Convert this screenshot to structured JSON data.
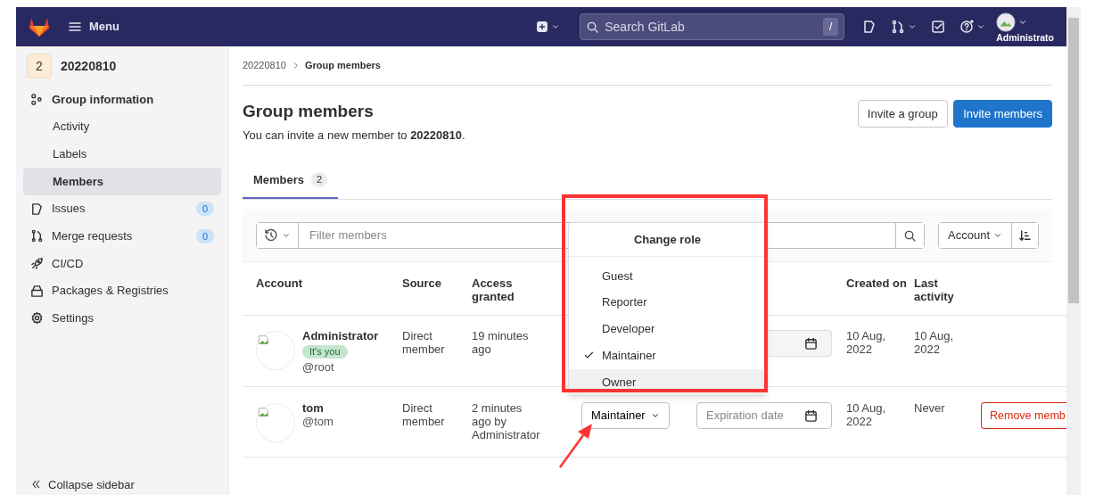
{
  "navbar": {
    "menu_label": "Menu",
    "search": {
      "placeholder": "Search GitLab",
      "shortcut": "/"
    },
    "user_label": "Administrato"
  },
  "sidebar": {
    "group_avatar": "2",
    "group_name": "20220810",
    "items": [
      {
        "label": "Group information",
        "selected": false,
        "children": [
          {
            "label": "Activity",
            "selected": false
          },
          {
            "label": "Labels",
            "selected": false
          },
          {
            "label": "Members",
            "selected": true
          }
        ]
      },
      {
        "label": "Issues",
        "selected": false,
        "count": "0"
      },
      {
        "label": "Merge requests",
        "selected": false,
        "count": "0"
      },
      {
        "label": "CI/CD",
        "selected": false
      },
      {
        "label": "Packages & Registries",
        "selected": false
      },
      {
        "label": "Settings",
        "selected": false
      }
    ],
    "collapse_label": "Collapse sidebar"
  },
  "breadcrumb": [
    {
      "label": "20220810",
      "current": false
    },
    {
      "label": "Group members",
      "current": true
    }
  ],
  "page": {
    "title": "Group members",
    "subtitle": "You can invite a new member to **20220810**.",
    "buttons": [
      {
        "label": "Invite a group",
        "kind": "secondary"
      },
      {
        "label": "Invite members",
        "kind": "primary"
      }
    ]
  },
  "tabs": [
    {
      "label": "Members",
      "count": "2",
      "selected": true
    }
  ],
  "filter": {
    "placeholder": "Filter members",
    "sort_label": "Account"
  },
  "table": {
    "columns": [
      "Account",
      "Source",
      "Access granted",
      "",
      "",
      "Created on",
      "Last activity",
      ""
    ],
    "rows": [
      {
        "name": "Administrator",
        "badge": "It's you",
        "username": "@root",
        "source": "Direct member",
        "access": "19 minutes ago",
        "created": "10 Aug, 2022",
        "last_activity": "10 Aug, 2022",
        "expiration": {}
      },
      {
        "name": "tom",
        "username": "@tom",
        "source": "Direct member",
        "access": "2 minutes ago by",
        "access_by": "Administrator",
        "role": "Maintainer",
        "expiration": {
          "placeholder": "Expiration date"
        },
        "created": "10 Aug, 2022",
        "last_activity": "Never",
        "action": "Remove memb"
      }
    ]
  },
  "role_menu": {
    "title": "Change role",
    "items": [
      {
        "label": "Guest",
        "checked": false,
        "hovered": false
      },
      {
        "label": "Reporter",
        "checked": false,
        "hovered": false
      },
      {
        "label": "Developer",
        "checked": false,
        "hovered": false
      },
      {
        "label": "Maintainer",
        "checked": true,
        "hovered": false
      },
      {
        "label": "Owner",
        "checked": false,
        "hovered": true
      }
    ]
  }
}
